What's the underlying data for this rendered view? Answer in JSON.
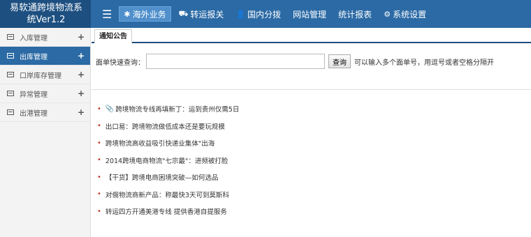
{
  "brand": {
    "line1": "易软通跨境物流系",
    "line2": "统Ver1.2"
  },
  "nav": [
    {
      "label": "海外业务",
      "icon": "asterisk-icon",
      "glyph": "✱",
      "active": true
    },
    {
      "label": "转运报关",
      "icon": "truck-icon",
      "glyph": "⛟",
      "active": false
    },
    {
      "label": "国内分拨",
      "icon": "user-icon",
      "glyph": "👤",
      "active": false
    },
    {
      "label": "网站管理",
      "icon": "",
      "glyph": "",
      "active": false
    },
    {
      "label": "统计报表",
      "icon": "",
      "glyph": "",
      "active": false
    },
    {
      "label": "系统设置",
      "icon": "cogs-icon",
      "glyph": "⚙",
      "active": false
    }
  ],
  "sidebar": {
    "items": [
      {
        "label": "入库管理",
        "active": false
      },
      {
        "label": "出库管理",
        "active": true
      },
      {
        "label": "口岸库存管理",
        "active": false
      },
      {
        "label": "异常管理",
        "active": false
      },
      {
        "label": "出港管理",
        "active": false
      }
    ]
  },
  "main": {
    "tab_label": "通知公告",
    "search": {
      "label": "面单快速查询：",
      "value": "",
      "placeholder": "",
      "button_label": "查询",
      "hint": "可以输入多个面单号，用逗号或者空格分隔开"
    },
    "news": [
      {
        "title": "跨境物流专线再填新丁：运到贵州仅需5日",
        "has_clip": true
      },
      {
        "title": "出口易：跨境物流做低成本还是要玩规模",
        "has_clip": false
      },
      {
        "title": "跨境物流高收益吸引快递业集体\"出海",
        "has_clip": false
      },
      {
        "title": "2014跨境电商物流\"七宗最\"：进频被打脸",
        "has_clip": false
      },
      {
        "title": "【干货】跨境电商困境突破—如何选品",
        "has_clip": false
      },
      {
        "title": "对俄物流商新产品：称最快3天可到莫斯科",
        "has_clip": false
      },
      {
        "title": "转运四方开通美港专线 提供香港自提服务",
        "has_clip": false
      }
    ]
  },
  "colors": {
    "topbar": "#2b6aa5",
    "brand_bg": "#1d4f80",
    "active_side": "#2b6aa5",
    "bullet": "#c0392b"
  }
}
